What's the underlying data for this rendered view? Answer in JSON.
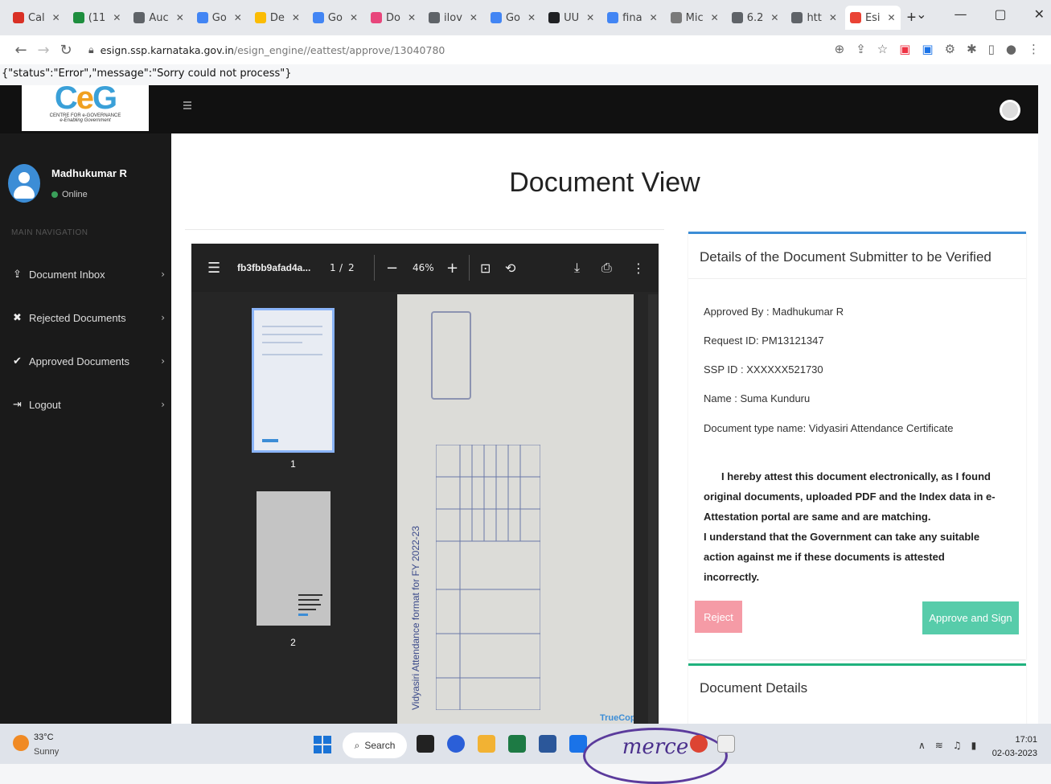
{
  "browser": {
    "tabs": [
      {
        "label": "Cal",
        "color": "#d93025"
      },
      {
        "label": "(11",
        "color": "#1e8e3e"
      },
      {
        "label": "Auc",
        "color": "#5f6368"
      },
      {
        "label": "Go",
        "color": "#4285f4"
      },
      {
        "label": "De",
        "color": "#fbbc04"
      },
      {
        "label": "Go",
        "color": "#4285f4"
      },
      {
        "label": "Do",
        "color": "#e8467c"
      },
      {
        "label": "ilov",
        "color": "#5f6368"
      },
      {
        "label": "Go",
        "color": "#4285f4"
      },
      {
        "label": "UU",
        "color": "#202124"
      },
      {
        "label": "fina",
        "color": "#4285f4"
      },
      {
        "label": "Mic",
        "color": "#7a7a7a"
      },
      {
        "label": "6.2",
        "color": "#5f6368"
      },
      {
        "label": "htt",
        "color": "#5f6368"
      },
      {
        "label": "Esi",
        "color": "#ea4335"
      }
    ],
    "url_host": "esign.ssp.karnataka.gov.in",
    "url_path": "/esign_engine//eattest/approve/13040780"
  },
  "error_text": "{\"status\":\"Error\",\"message\":\"Sorry could not process\"}",
  "logo": {
    "text1": "CENTRE FOR e-GOVERNANCE",
    "text2": "e-Enabling Government"
  },
  "user": {
    "name": "Madhukumar R",
    "status": "Online"
  },
  "sidebar": {
    "heading": "MAIN NAVIGATION",
    "items": [
      {
        "label": "Document Inbox",
        "icon": "upload-icon"
      },
      {
        "label": "Rejected Documents",
        "icon": "cross-icon"
      },
      {
        "label": "Approved Documents",
        "icon": "check-icon"
      },
      {
        "label": "Logout",
        "icon": "logout-icon"
      }
    ]
  },
  "page_title": "Document View",
  "pdf": {
    "filename": "fb3fbb9afad4a...",
    "page": "1",
    "page_total": "2",
    "zoom": "46%",
    "thumbs": [
      "1",
      "2"
    ],
    "doc_heading": "Vidyasiri Attendance format for FY 2022-23",
    "watermark": "TrueCopy"
  },
  "details": {
    "title": "Details of the Document Submitter to be Verified",
    "approved_by": "Approved By : Madhukumar R",
    "request_id": "Request ID: PM13121347",
    "ssp_id": "SSP ID : XXXXXX521730",
    "name": "Name : Suma Kunduru",
    "doc_type": "Document type name: Vidyasiri Attendance Certificate",
    "attest_line1": "I hereby attest this document electronically, as I found original documents, uploaded PDF and the Index data in e-Attestation portal are same and are matching.",
    "attest_line2": "I understand that the Government can take any suitable action against me if these documents is attested incorrectly.",
    "reject_label": "Reject",
    "approve_label": "Approve and Sign",
    "colors": {
      "reject": "#f59ba6",
      "approve": "#57ccaa",
      "accent": "#3c8dd6"
    }
  },
  "document_details": {
    "title": "Document Details"
  },
  "taskbar": {
    "temp": "33°C",
    "condition": "Sunny",
    "search": "Search",
    "time": "17:01",
    "date": "02-03-2023",
    "stamp": "merce"
  }
}
